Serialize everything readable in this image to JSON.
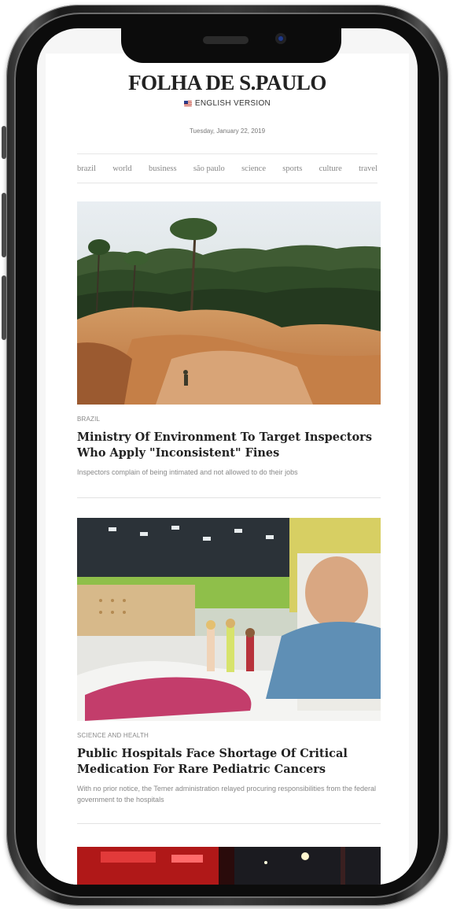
{
  "site": {
    "name": "FOLHA DE S.PAULO",
    "edition": "ENGLISH VERSION",
    "date": "Tuesday, January 22, 2019"
  },
  "nav": [
    "brazil",
    "world",
    "business",
    "são paulo",
    "science",
    "sports",
    "culture",
    "travel"
  ],
  "articles": [
    {
      "kicker": "BRAZIL",
      "headline": "Ministry Of Environment To Target Inspectors Who Apply \"Inconsistent\" Fines",
      "summary": "Inspectors complain of being intimated and not allowed to do their jobs"
    },
    {
      "kicker": "SCIENCE AND HEALTH",
      "headline": "Public Hospitals Face Shortage Of Critical Medication For Rare Pediatric Cancers",
      "summary": "With no prior notice, the Temer administration relayed procuring responsibilities from the federal government to the hospitals"
    }
  ],
  "icons": {
    "flag": "us-flag-icon"
  },
  "colors": {
    "frame": "#1b1b1b",
    "headline": "#222222",
    "muted": "#888888"
  }
}
